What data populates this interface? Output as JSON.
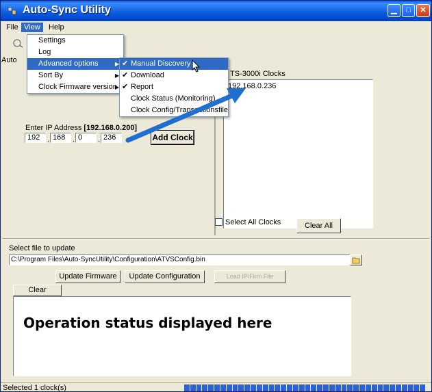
{
  "window": {
    "title": "Auto-Sync Utility"
  },
  "menubar": {
    "file": "File",
    "view": "View",
    "help": "Help"
  },
  "toolbar": {
    "cut_label": "Auto"
  },
  "view_menu": {
    "items": [
      {
        "label": "Settings",
        "submenu": false
      },
      {
        "label": "Log",
        "submenu": false
      },
      {
        "label": "Advanced options",
        "submenu": true
      },
      {
        "label": "Sort By",
        "submenu": true
      },
      {
        "label": "Clock Firmware version",
        "submenu": true
      }
    ]
  },
  "advanced_menu": {
    "items": [
      {
        "label": "Manual Discovery",
        "checked": true
      },
      {
        "label": "Download",
        "checked": true
      },
      {
        "label": "Report",
        "checked": true
      },
      {
        "label": "Clock Status (Monitoring)",
        "checked": false
      },
      {
        "label": "Clock Config/Transactionsfile",
        "checked": false
      }
    ]
  },
  "clock_panel": {
    "header": "TS-3000i Clocks",
    "clocks": [
      "192.168.0.236"
    ],
    "select_all_label": "Select All Clocks",
    "clear_all_label": "Clear All"
  },
  "ip_entry": {
    "label": "Enter IP Address",
    "current": "[192.168.0.200]",
    "octets": [
      "192",
      "168",
      "0",
      "236"
    ],
    "add_button": "Add Clock"
  },
  "file_section": {
    "label": "Select file to update",
    "path": "C:\\Program Files\\Auto-SyncUtility\\Configuration\\ATVSConfig.bin",
    "update_firmware": "Update Firmware",
    "update_configuration": "Update Configuration",
    "load_ip_file": "Load IP/Firm File"
  },
  "status_area": {
    "clear_tab": "Clear",
    "overlay_text": "Operation status displayed here"
  },
  "statusbar": {
    "text": "Selected 1 clock(s)",
    "progress": 1.0
  },
  "colors": {
    "arrow": "#1f6fd0",
    "title_bar": "#0a5ce0",
    "selection": "#316ac5"
  }
}
